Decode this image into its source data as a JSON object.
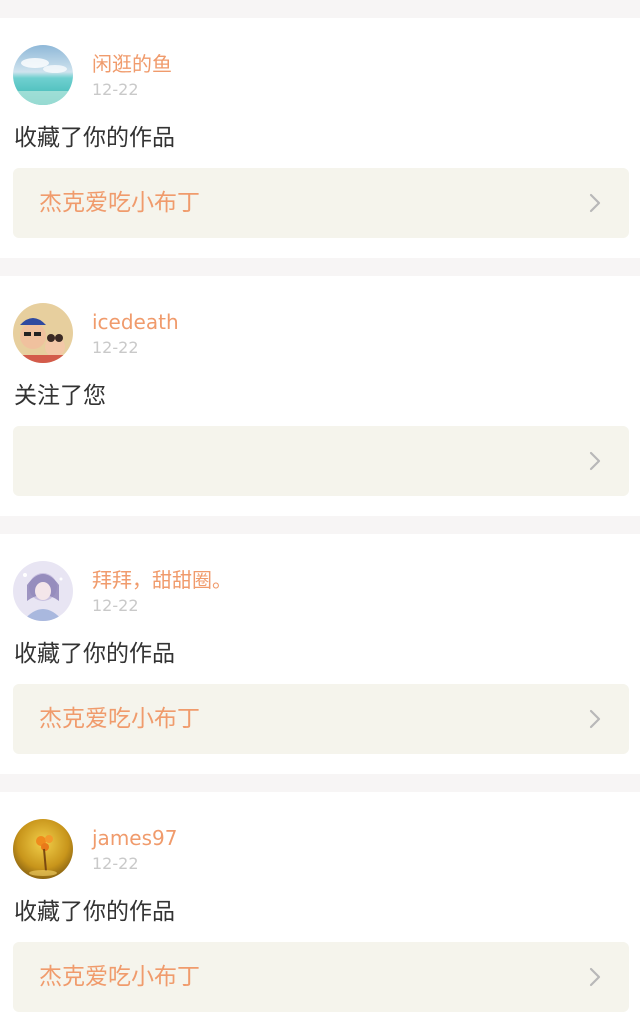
{
  "feed": {
    "items": [
      {
        "username": "闲逛的鱼",
        "date": "12-22",
        "action": "收藏了你的作品",
        "work_title": "杰克爱吃小布丁"
      },
      {
        "username": "icedeath",
        "date": "12-22",
        "action": "关注了您",
        "work_title": ""
      },
      {
        "username": "拜拜，甜甜圈。",
        "date": "12-22",
        "action": "收藏了你的作品",
        "work_title": "杰克爱吃小布丁"
      },
      {
        "username": "james97",
        "date": "12-22",
        "action": "收藏了你的作品",
        "work_title": "杰克爱吃小布丁"
      }
    ]
  },
  "colors": {
    "accent": "#f09b6c",
    "date_text": "#c9c9c9",
    "body_text": "#333333",
    "link_box_bg": "#f5f4ec",
    "divider_bg": "#f7f5f5"
  },
  "icons": {
    "chevron": "chevron-right-icon"
  }
}
